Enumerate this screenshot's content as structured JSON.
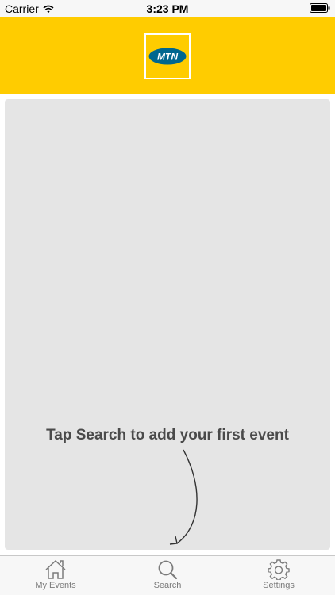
{
  "status_bar": {
    "carrier": "Carrier",
    "time": "3:23 PM",
    "wifi_icon": "wifi-icon",
    "battery_icon": "battery-icon"
  },
  "header": {
    "logo_text": "MTN",
    "background_color": "#ffcc00"
  },
  "main": {
    "hint": "Tap Search to add your first event",
    "arrow_icon": "curved-arrow-down-icon"
  },
  "tab_bar": {
    "tabs": [
      {
        "label": "My Events",
        "icon": "home-icon"
      },
      {
        "label": "Search",
        "icon": "search-icon"
      },
      {
        "label": "Settings",
        "icon": "gear-icon"
      }
    ]
  }
}
